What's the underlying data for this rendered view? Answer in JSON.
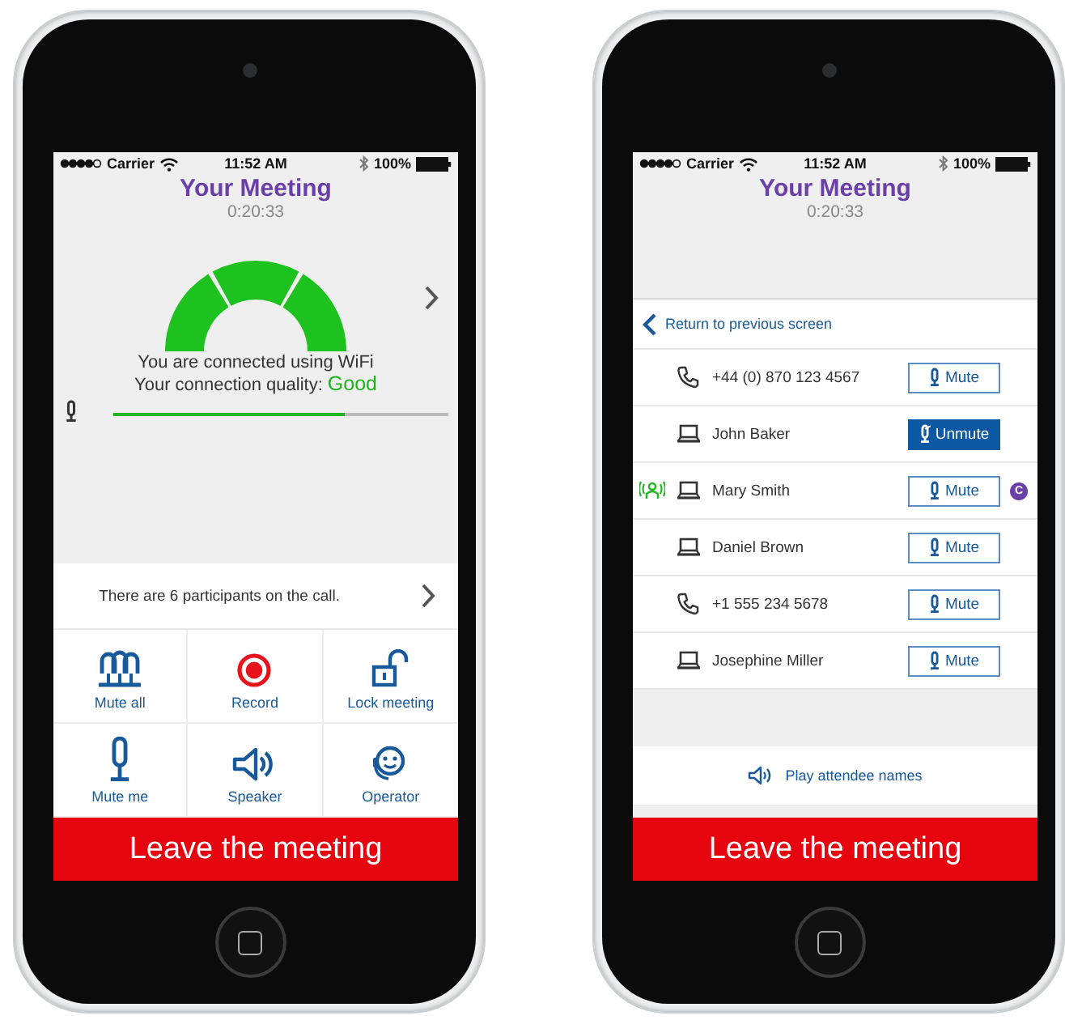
{
  "screens": [
    {
      "kind": "meeting",
      "status_bar": {
        "carrier": "Carrier",
        "time": "11:52 AM",
        "battery": "100%"
      },
      "title": "Your Meeting",
      "timer": "0:20:33",
      "connection": {
        "line": "You are connected using WiFi",
        "quality_label": "Your connection quality:",
        "quality": "Good"
      },
      "mic": {
        "level": 0.69
      },
      "participants_summary": "There are 6 participants on the call.",
      "actions": [
        {
          "label": "Mute all"
        },
        {
          "label": "Record"
        },
        {
          "label": "Lock meeting"
        },
        {
          "label": "Mute me"
        },
        {
          "label": "Speaker"
        },
        {
          "label": "Operator"
        }
      ],
      "leave_button": "Leave the meeting"
    },
    {
      "kind": "participants",
      "status_bar": {
        "carrier": "Carrier",
        "time": "11:52 AM",
        "battery": "100%"
      },
      "title": "Your Meeting",
      "timer": "0:20:33",
      "back_link": "Return to previous screen",
      "participants": [
        {
          "kind": "phone",
          "name": "+44 (0) 870 123 4567",
          "button": "Mute",
          "muted": false,
          "speaking": false
        },
        {
          "kind": "computer",
          "name": "John Baker",
          "button": "Unmute",
          "muted": true,
          "speaking": false
        },
        {
          "kind": "computer",
          "name": "Mary Smith",
          "button": "Mute",
          "muted": false,
          "speaking": true,
          "badge": "C"
        },
        {
          "kind": "computer",
          "name": "Daniel Brown",
          "button": "Mute",
          "muted": false,
          "speaking": false
        },
        {
          "kind": "phone",
          "name": "+1 555 234 5678",
          "button": "Mute",
          "muted": false,
          "speaking": false
        },
        {
          "kind": "computer",
          "name": "Josephine Miller",
          "button": "Mute",
          "muted": false,
          "speaking": false
        }
      ],
      "play_button": "Play attendee names",
      "leave_button": "Leave the meeting"
    }
  ]
}
